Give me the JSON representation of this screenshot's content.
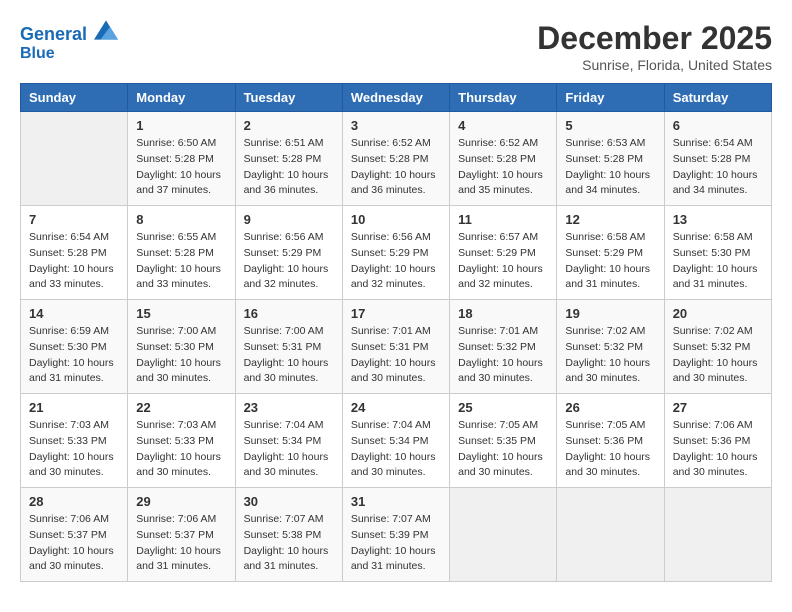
{
  "logo": {
    "line1": "General",
    "line2": "Blue"
  },
  "title": "December 2025",
  "subtitle": "Sunrise, Florida, United States",
  "weekdays": [
    "Sunday",
    "Monday",
    "Tuesday",
    "Wednesday",
    "Thursday",
    "Friday",
    "Saturday"
  ],
  "weeks": [
    [
      {
        "day": "",
        "empty": true
      },
      {
        "day": "1",
        "sunrise": "Sunrise: 6:50 AM",
        "sunset": "Sunset: 5:28 PM",
        "daylight": "Daylight: 10 hours and 37 minutes."
      },
      {
        "day": "2",
        "sunrise": "Sunrise: 6:51 AM",
        "sunset": "Sunset: 5:28 PM",
        "daylight": "Daylight: 10 hours and 36 minutes."
      },
      {
        "day": "3",
        "sunrise": "Sunrise: 6:52 AM",
        "sunset": "Sunset: 5:28 PM",
        "daylight": "Daylight: 10 hours and 36 minutes."
      },
      {
        "day": "4",
        "sunrise": "Sunrise: 6:52 AM",
        "sunset": "Sunset: 5:28 PM",
        "daylight": "Daylight: 10 hours and 35 minutes."
      },
      {
        "day": "5",
        "sunrise": "Sunrise: 6:53 AM",
        "sunset": "Sunset: 5:28 PM",
        "daylight": "Daylight: 10 hours and 34 minutes."
      },
      {
        "day": "6",
        "sunrise": "Sunrise: 6:54 AM",
        "sunset": "Sunset: 5:28 PM",
        "daylight": "Daylight: 10 hours and 34 minutes."
      }
    ],
    [
      {
        "day": "7",
        "sunrise": "Sunrise: 6:54 AM",
        "sunset": "Sunset: 5:28 PM",
        "daylight": "Daylight: 10 hours and 33 minutes."
      },
      {
        "day": "8",
        "sunrise": "Sunrise: 6:55 AM",
        "sunset": "Sunset: 5:28 PM",
        "daylight": "Daylight: 10 hours and 33 minutes."
      },
      {
        "day": "9",
        "sunrise": "Sunrise: 6:56 AM",
        "sunset": "Sunset: 5:29 PM",
        "daylight": "Daylight: 10 hours and 32 minutes."
      },
      {
        "day": "10",
        "sunrise": "Sunrise: 6:56 AM",
        "sunset": "Sunset: 5:29 PM",
        "daylight": "Daylight: 10 hours and 32 minutes."
      },
      {
        "day": "11",
        "sunrise": "Sunrise: 6:57 AM",
        "sunset": "Sunset: 5:29 PM",
        "daylight": "Daylight: 10 hours and 32 minutes."
      },
      {
        "day": "12",
        "sunrise": "Sunrise: 6:58 AM",
        "sunset": "Sunset: 5:29 PM",
        "daylight": "Daylight: 10 hours and 31 minutes."
      },
      {
        "day": "13",
        "sunrise": "Sunrise: 6:58 AM",
        "sunset": "Sunset: 5:30 PM",
        "daylight": "Daylight: 10 hours and 31 minutes."
      }
    ],
    [
      {
        "day": "14",
        "sunrise": "Sunrise: 6:59 AM",
        "sunset": "Sunset: 5:30 PM",
        "daylight": "Daylight: 10 hours and 31 minutes."
      },
      {
        "day": "15",
        "sunrise": "Sunrise: 7:00 AM",
        "sunset": "Sunset: 5:30 PM",
        "daylight": "Daylight: 10 hours and 30 minutes."
      },
      {
        "day": "16",
        "sunrise": "Sunrise: 7:00 AM",
        "sunset": "Sunset: 5:31 PM",
        "daylight": "Daylight: 10 hours and 30 minutes."
      },
      {
        "day": "17",
        "sunrise": "Sunrise: 7:01 AM",
        "sunset": "Sunset: 5:31 PM",
        "daylight": "Daylight: 10 hours and 30 minutes."
      },
      {
        "day": "18",
        "sunrise": "Sunrise: 7:01 AM",
        "sunset": "Sunset: 5:32 PM",
        "daylight": "Daylight: 10 hours and 30 minutes."
      },
      {
        "day": "19",
        "sunrise": "Sunrise: 7:02 AM",
        "sunset": "Sunset: 5:32 PM",
        "daylight": "Daylight: 10 hours and 30 minutes."
      },
      {
        "day": "20",
        "sunrise": "Sunrise: 7:02 AM",
        "sunset": "Sunset: 5:32 PM",
        "daylight": "Daylight: 10 hours and 30 minutes."
      }
    ],
    [
      {
        "day": "21",
        "sunrise": "Sunrise: 7:03 AM",
        "sunset": "Sunset: 5:33 PM",
        "daylight": "Daylight: 10 hours and 30 minutes."
      },
      {
        "day": "22",
        "sunrise": "Sunrise: 7:03 AM",
        "sunset": "Sunset: 5:33 PM",
        "daylight": "Daylight: 10 hours and 30 minutes."
      },
      {
        "day": "23",
        "sunrise": "Sunrise: 7:04 AM",
        "sunset": "Sunset: 5:34 PM",
        "daylight": "Daylight: 10 hours and 30 minutes."
      },
      {
        "day": "24",
        "sunrise": "Sunrise: 7:04 AM",
        "sunset": "Sunset: 5:34 PM",
        "daylight": "Daylight: 10 hours and 30 minutes."
      },
      {
        "day": "25",
        "sunrise": "Sunrise: 7:05 AM",
        "sunset": "Sunset: 5:35 PM",
        "daylight": "Daylight: 10 hours and 30 minutes."
      },
      {
        "day": "26",
        "sunrise": "Sunrise: 7:05 AM",
        "sunset": "Sunset: 5:36 PM",
        "daylight": "Daylight: 10 hours and 30 minutes."
      },
      {
        "day": "27",
        "sunrise": "Sunrise: 7:06 AM",
        "sunset": "Sunset: 5:36 PM",
        "daylight": "Daylight: 10 hours and 30 minutes."
      }
    ],
    [
      {
        "day": "28",
        "sunrise": "Sunrise: 7:06 AM",
        "sunset": "Sunset: 5:37 PM",
        "daylight": "Daylight: 10 hours and 30 minutes."
      },
      {
        "day": "29",
        "sunrise": "Sunrise: 7:06 AM",
        "sunset": "Sunset: 5:37 PM",
        "daylight": "Daylight: 10 hours and 31 minutes."
      },
      {
        "day": "30",
        "sunrise": "Sunrise: 7:07 AM",
        "sunset": "Sunset: 5:38 PM",
        "daylight": "Daylight: 10 hours and 31 minutes."
      },
      {
        "day": "31",
        "sunrise": "Sunrise: 7:07 AM",
        "sunset": "Sunset: 5:39 PM",
        "daylight": "Daylight: 10 hours and 31 minutes."
      },
      {
        "day": "",
        "empty": true
      },
      {
        "day": "",
        "empty": true
      },
      {
        "day": "",
        "empty": true
      }
    ]
  ]
}
